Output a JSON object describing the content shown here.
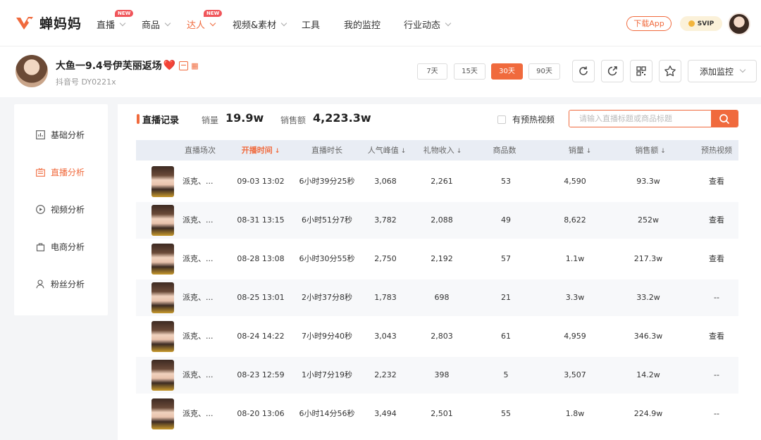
{
  "app": {
    "name": "蝉妈妈"
  },
  "nav": {
    "items": [
      {
        "label": "直播",
        "new": true,
        "chevron": true
      },
      {
        "label": "商品",
        "new": false,
        "chevron": true
      },
      {
        "label": "达人",
        "new": true,
        "chevron": true,
        "active": true
      },
      {
        "label": "视频&素材",
        "new": false,
        "chevron": true
      },
      {
        "label": "工具",
        "new": false,
        "chevron": false
      },
      {
        "label": "我的监控",
        "new": false,
        "chevron": false
      },
      {
        "label": "行业动态",
        "new": false,
        "chevron": true
      }
    ],
    "new_badge": "NEW",
    "download_label": "下载App",
    "svip_label": "SVIP"
  },
  "profile": {
    "name": "大鱼一9.4号伊芙丽返场",
    "heart": "❤️",
    "douyin_id": "抖音号 DY0221x",
    "ranges": [
      "7天",
      "15天",
      "30天",
      "90天"
    ],
    "active_range": "30天",
    "add_monitor_label": "添加监控"
  },
  "sidebar": {
    "items": [
      {
        "label": "基础分析",
        "icon": "chart-icon"
      },
      {
        "label": "直播分析",
        "icon": "live-icon",
        "active": true
      },
      {
        "label": "视频分析",
        "icon": "play-icon"
      },
      {
        "label": "电商分析",
        "icon": "bag-icon"
      },
      {
        "label": "粉丝分析",
        "icon": "user-icon"
      }
    ]
  },
  "main": {
    "section_title": "直播记录",
    "sales_label": "销量",
    "sales_value": "19.9w",
    "revenue_label": "销售额",
    "revenue_value": "4,223.3w",
    "preheat_label": "有预热视频",
    "search_placeholder": "请输入直播标题或商品标题",
    "accent": "#f06a3d"
  },
  "table": {
    "headers": [
      "直播场次",
      "开播时间",
      "直播时长",
      "人气峰值",
      "礼物收入",
      "商品数",
      "销量",
      "销售额",
      "预热视频"
    ],
    "rows": [
      {
        "title": "派克、...",
        "start": "09-03 13:02",
        "duration": "6小时39分25秒",
        "peak": "3,068",
        "gift": "2,261",
        "products": "53",
        "sales": "4,590",
        "revenue": "93.3w",
        "preheat": "查看"
      },
      {
        "title": "派克、...",
        "start": "08-31 13:15",
        "duration": "6小时51分7秒",
        "peak": "3,782",
        "gift": "2,088",
        "products": "49",
        "sales": "8,622",
        "revenue": "252w",
        "preheat": "查看"
      },
      {
        "title": "派克、...",
        "start": "08-28 13:08",
        "duration": "6小时30分55秒",
        "peak": "2,750",
        "gift": "2,192",
        "products": "57",
        "sales": "1.1w",
        "revenue": "217.3w",
        "preheat": "查看"
      },
      {
        "title": "派克、...",
        "start": "08-25 13:01",
        "duration": "2小时37分8秒",
        "peak": "1,783",
        "gift": "698",
        "products": "21",
        "sales": "3.3w",
        "revenue": "33.2w",
        "preheat": "--"
      },
      {
        "title": "派克、...",
        "start": "08-24 14:22",
        "duration": "7小时9分40秒",
        "peak": "3,043",
        "gift": "2,803",
        "products": "61",
        "sales": "4,959",
        "revenue": "346.3w",
        "preheat": "查看"
      },
      {
        "title": "派克、...",
        "start": "08-23 12:59",
        "duration": "1小时7分19秒",
        "peak": "2,232",
        "gift": "398",
        "products": "5",
        "sales": "3,507",
        "revenue": "14.2w",
        "preheat": "--"
      },
      {
        "title": "派克、...",
        "start": "08-20 13:06",
        "duration": "6小时14分56秒",
        "peak": "3,494",
        "gift": "2,501",
        "products": "55",
        "sales": "1.8w",
        "revenue": "224.9w",
        "preheat": "--"
      }
    ]
  }
}
